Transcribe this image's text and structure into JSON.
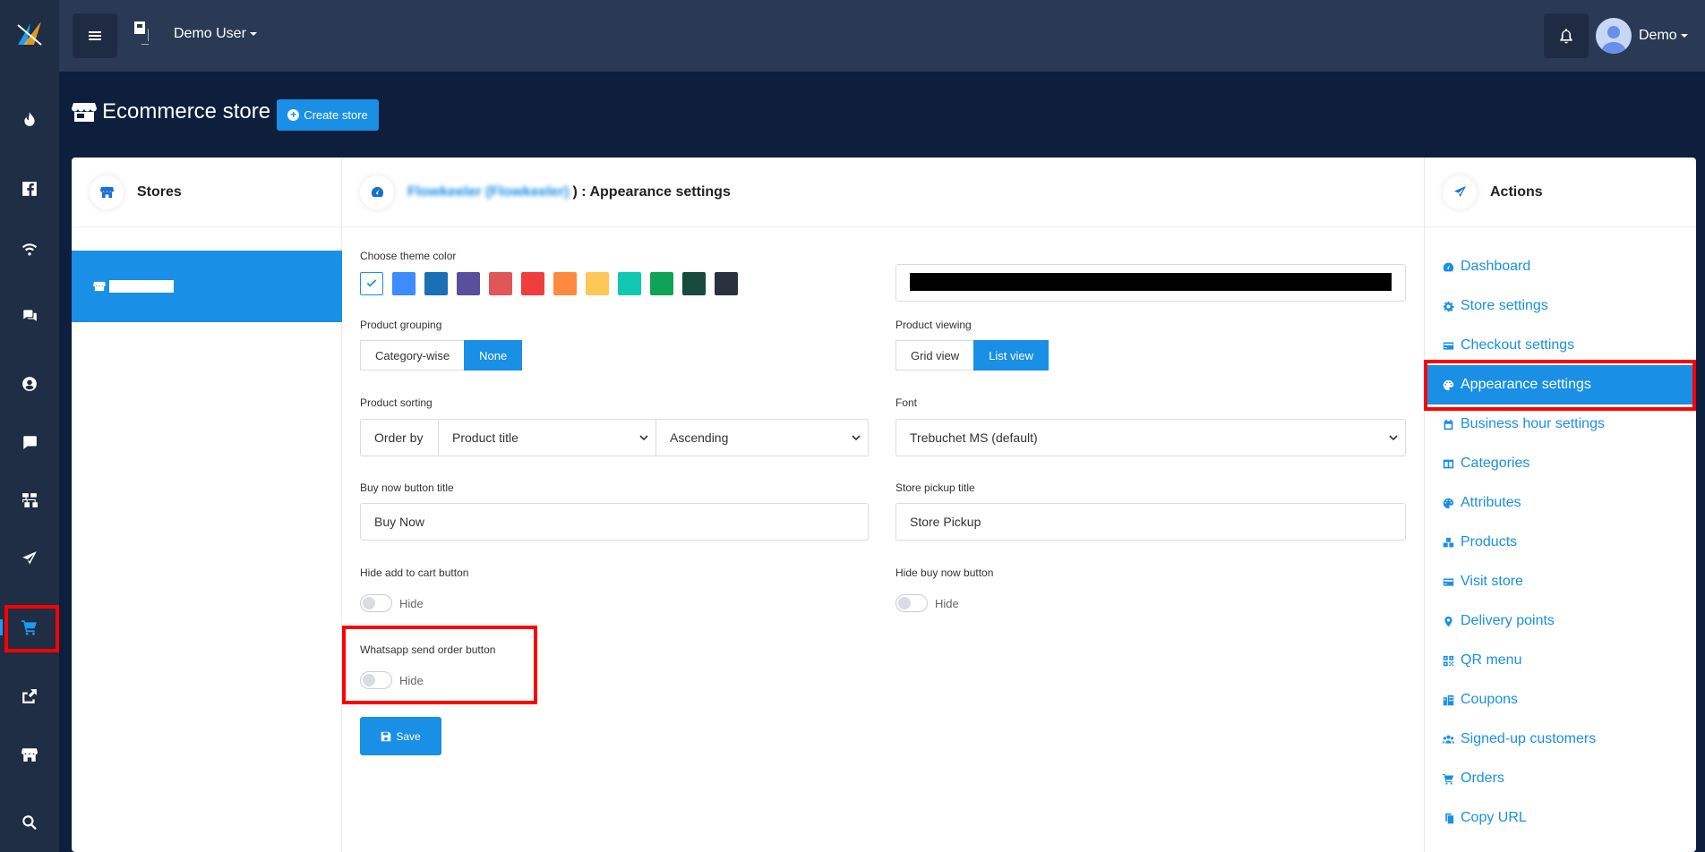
{
  "topbar": {
    "user_label": "Demo User",
    "account_label": "Demo"
  },
  "page": {
    "title": "Ecommerce store",
    "create_button": "Create store"
  },
  "stores_panel": {
    "title": "Stores"
  },
  "main_panel": {
    "title_blurred": "Flowkeeler (Flowkeeler)",
    "title": ") : Appearance settings",
    "theme_color_label": "Choose theme color",
    "theme_colors": [
      "#1a8fe6",
      "#3d8bfd",
      "#1a6fb5",
      "#5a4f9d",
      "#e15759",
      "#f03e3e",
      "#fd8a3e",
      "#ffc658",
      "#12c8b2",
      "#0fa358",
      "#17493d",
      "#29313e"
    ],
    "product_grouping_label": "Product grouping",
    "grouping_options": [
      "Category-wise",
      "None"
    ],
    "grouping_selected": "None",
    "product_viewing_label": "Product viewing",
    "viewing_options": [
      "Grid view",
      "List view"
    ],
    "viewing_selected": "List view",
    "product_sorting_label": "Product sorting",
    "order_by_label": "Order by",
    "sort_field": "Product title",
    "sort_direction": "Ascending",
    "font_label": "Font",
    "font_value": "Trebuchet MS (default)",
    "buy_now_title_label": "Buy now button title",
    "buy_now_title_value": "Buy Now",
    "store_pickup_title_label": "Store pickup title",
    "store_pickup_title_value": "Store Pickup",
    "hide_add_to_cart_label": "Hide add to cart button",
    "hide_buy_now_label": "Hide buy now button",
    "whatsapp_label": "Whatsapp send order button",
    "toggle_text": "Hide",
    "save_label": "Save"
  },
  "actions_panel": {
    "title": "Actions",
    "items": [
      {
        "label": "Dashboard",
        "icon": "dashboard-icon"
      },
      {
        "label": "Store settings",
        "icon": "gear-icon"
      },
      {
        "label": "Checkout settings",
        "icon": "credit-card-icon"
      },
      {
        "label": "Appearance settings",
        "icon": "palette-icon",
        "active": true
      },
      {
        "label": "Business hour settings",
        "icon": "calendar-icon"
      },
      {
        "label": "Categories",
        "icon": "columns-icon"
      },
      {
        "label": "Attributes",
        "icon": "palette-icon"
      },
      {
        "label": "Products",
        "icon": "boxes-icon"
      },
      {
        "label": "Visit store",
        "icon": "credit-card-icon"
      },
      {
        "label": "Delivery points",
        "icon": "map-marker-icon"
      },
      {
        "label": "QR menu",
        "icon": "qrcode-icon"
      },
      {
        "label": "Coupons",
        "icon": "building-icon"
      },
      {
        "label": "Signed-up customers",
        "icon": "users-icon"
      },
      {
        "label": "Orders",
        "icon": "cart-icon"
      },
      {
        "label": "Copy URL",
        "icon": "copy-icon"
      }
    ]
  },
  "colors": {
    "accent": "#1a8fe6",
    "rail_bg": "#1f2d45",
    "topbar_bg": "#2a3a55",
    "page_bg": "#0d1f3d",
    "highlight": "#ff0000"
  }
}
